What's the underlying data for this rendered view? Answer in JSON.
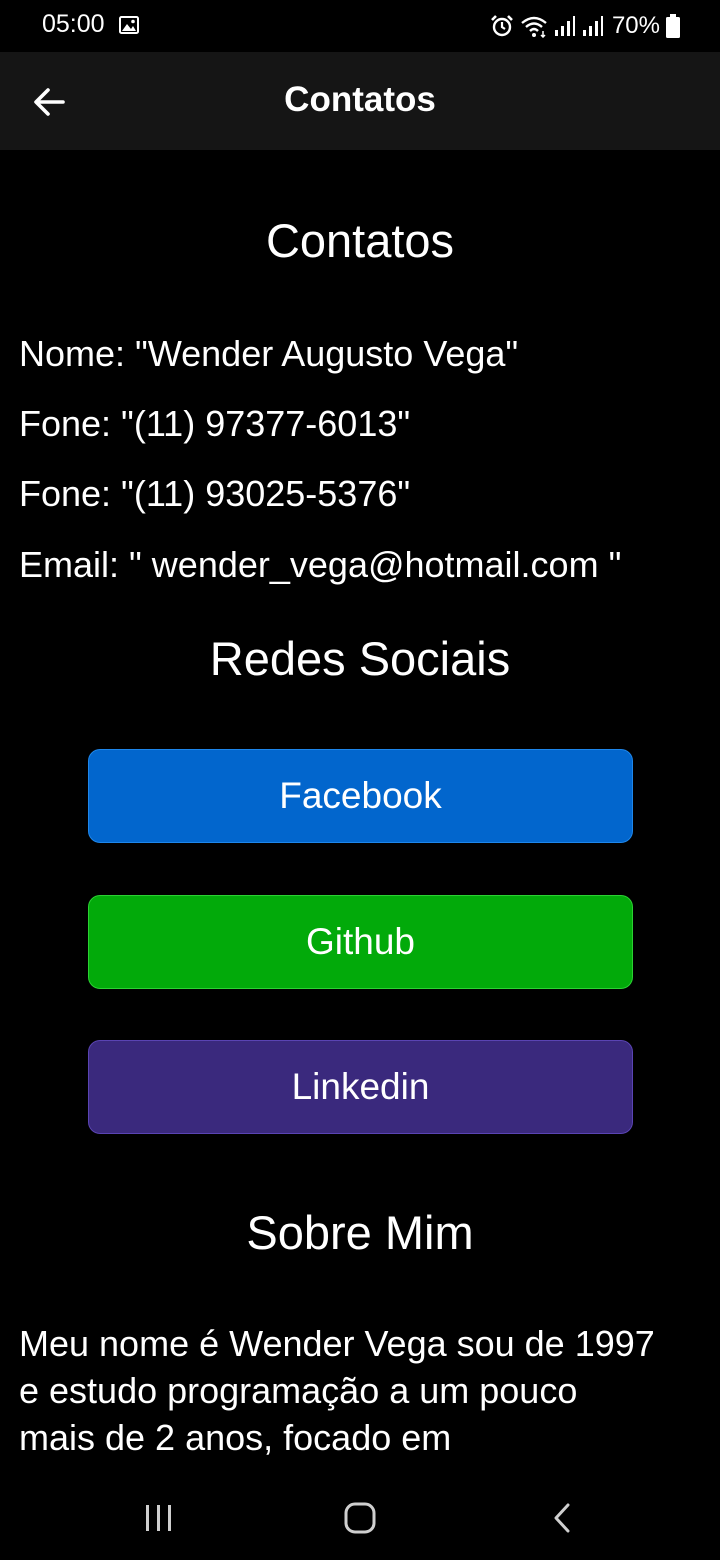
{
  "status_bar": {
    "time": "05:00",
    "battery": "70%",
    "icons": [
      "gallery-icon",
      "alarm-icon",
      "wifi-icon",
      "signal-icon",
      "signal-icon",
      "battery-icon"
    ]
  },
  "app_bar": {
    "title": "Contatos",
    "back_icon": "arrow-left-icon"
  },
  "sections": {
    "contatos_heading": "Contatos",
    "contacts": {
      "nome": "Nome: \"Wender Augusto Vega\"",
      "fone1": "Fone: \"(11) 97377-6013\"",
      "fone2": "Fone: \"(11) 93025-5376\"",
      "email": "Email: \" wender_vega@hotmail.com \""
    },
    "redes_heading": "Redes Sociais",
    "social_buttons": [
      {
        "label": "Facebook",
        "color": "#0266cd"
      },
      {
        "label": "Github",
        "color": "#02aa0a"
      },
      {
        "label": "Linkedin",
        "color": "#3a297d"
      }
    ],
    "sobre_heading": "Sobre Mim",
    "about_text": "Meu nome é Wender Vega sou de 1997 e estudo programação a um pouco mais de 2 anos, focado em"
  },
  "nav_bar": {
    "icons": [
      "recents-icon",
      "home-icon",
      "back-icon"
    ]
  },
  "colors": {
    "background": "#000000",
    "app_bar": "#151515",
    "text": "#ffffff"
  }
}
